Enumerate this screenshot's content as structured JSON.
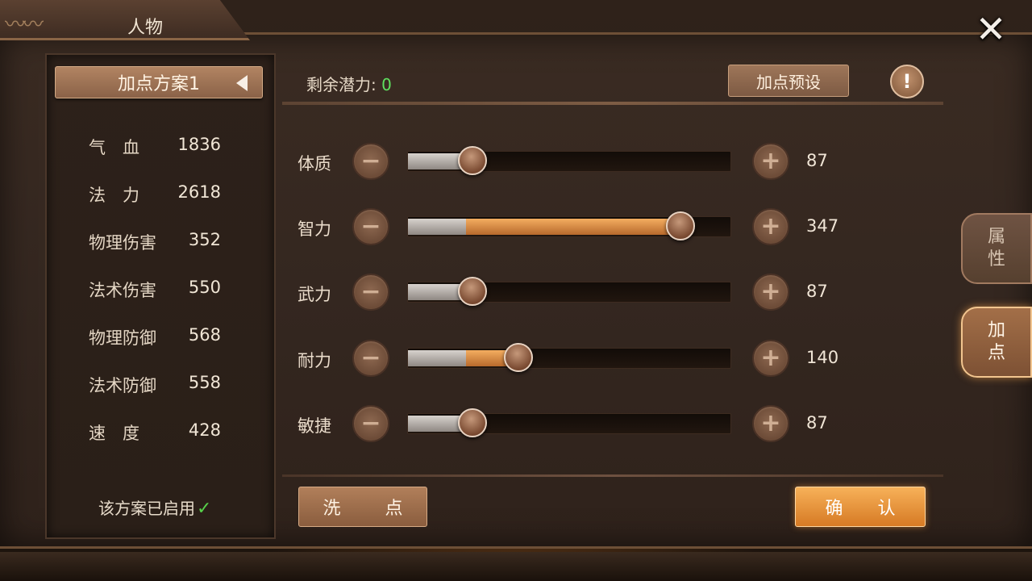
{
  "window": {
    "title": "人物",
    "close_icon": "close-icon"
  },
  "plan": {
    "name": "加点方案1",
    "enabled_text": "该方案已启用",
    "enabled_check": "✓"
  },
  "stats": [
    {
      "label": "气　血",
      "value": "1836"
    },
    {
      "label": "法　力",
      "value": "2618"
    },
    {
      "label": "物理伤害",
      "value": "352"
    },
    {
      "label": "法术伤害",
      "value": "550"
    },
    {
      "label": "物理防御",
      "value": "568"
    },
    {
      "label": "法术防御",
      "value": "558"
    },
    {
      "label": "速　度",
      "value": "428"
    }
  ],
  "potential": {
    "label": "剩余潜力:",
    "value": "0"
  },
  "buttons": {
    "preset": "加点预设",
    "info": "!",
    "reset": "洗 点",
    "confirm": "确 认",
    "minus": "−",
    "plus": "+"
  },
  "attributes": [
    {
      "name": "体质",
      "value": "87",
      "base_fraction": 0.2,
      "added_fraction": 0.0
    },
    {
      "name": "智力",
      "value": "347",
      "base_fraction": 0.18,
      "added_fraction": 0.66
    },
    {
      "name": "武力",
      "value": "87",
      "base_fraction": 0.2,
      "added_fraction": 0.0
    },
    {
      "name": "耐力",
      "value": "140",
      "base_fraction": 0.18,
      "added_fraction": 0.16
    },
    {
      "name": "敏捷",
      "value": "87",
      "base_fraction": 0.2,
      "added_fraction": 0.0
    }
  ],
  "side_tabs": [
    {
      "label_line1": "属",
      "label_line2": "性",
      "active": false
    },
    {
      "label_line1": "加",
      "label_line2": "点",
      "active": true
    }
  ],
  "colors": {
    "accent_orange": "#e38a35",
    "potential_green": "#5fe05f",
    "check_green": "#57d14a"
  }
}
